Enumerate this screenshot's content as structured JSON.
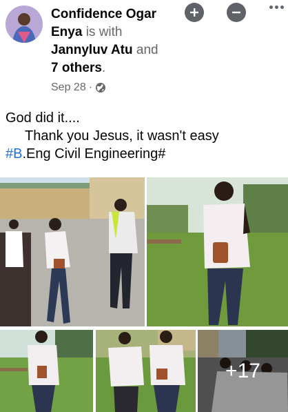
{
  "post": {
    "author": "Confidence Ogar Enya",
    "author_line1": "Confidence Ogar",
    "author_line2": "Enya",
    "is_with": "is with",
    "tagged": "Jannyluv Atu",
    "and": "and",
    "others": "7 others",
    "period": ".",
    "date": "Sep 28",
    "separator": "·",
    "privacy_icon": "globe-icon",
    "text_line1": "God did it....",
    "text_line2": "Thank you Jesus, it wasn't easy",
    "hashtag_prefix": "#B",
    "hashtag_rest": ".Eng Civil Engineering#",
    "extra_photos_count": "+17"
  },
  "actions": {
    "add_icon": "plus-circle-icon",
    "minus_icon": "minus-circle-icon",
    "more_icon": "more-horizontal-icon"
  },
  "colors": {
    "hashtag": "#216fdb",
    "secondary_text": "#65676b"
  }
}
